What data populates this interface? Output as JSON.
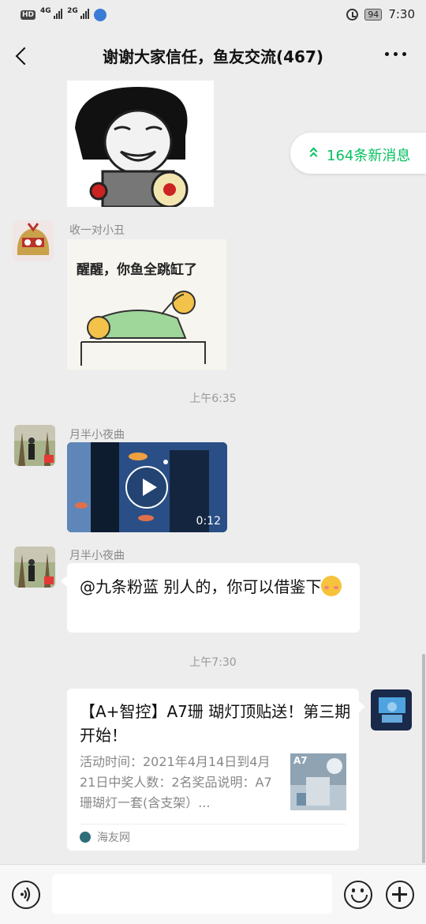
{
  "status_bar": {
    "hd_label": "HD",
    "network_1": "4G",
    "network_2": "2G",
    "battery": "94",
    "time": "7:30"
  },
  "header": {
    "title": "谢谢大家信任，鱼友交流(467)"
  },
  "new_messages": {
    "label": "164条新消息"
  },
  "messages": [
    {
      "sender": "收一对小丑",
      "sticker_text": "醒醒，你鱼全跳缸了"
    },
    {
      "timestamp": "上午6:35"
    },
    {
      "sender": "月半小夜曲",
      "video_duration": "0:12"
    },
    {
      "sender": "月半小夜曲",
      "text": "@九条粉蓝  别人的，你可以借鉴下"
    },
    {
      "timestamp": "上午7:30"
    },
    {
      "link_title": "【A+智控】A7珊 瑚灯顶贴送！第三期开始！",
      "link_desc": "活动时间：2021年4月14日到4月21日中奖人数：2名奖品说明：A7珊瑚灯一套(含支架）...",
      "link_thumb_label": "A7",
      "link_source": "海友网"
    }
  ],
  "colors": {
    "background": "#ededed",
    "accent_green": "#07c160",
    "bubble": "#ffffff"
  }
}
